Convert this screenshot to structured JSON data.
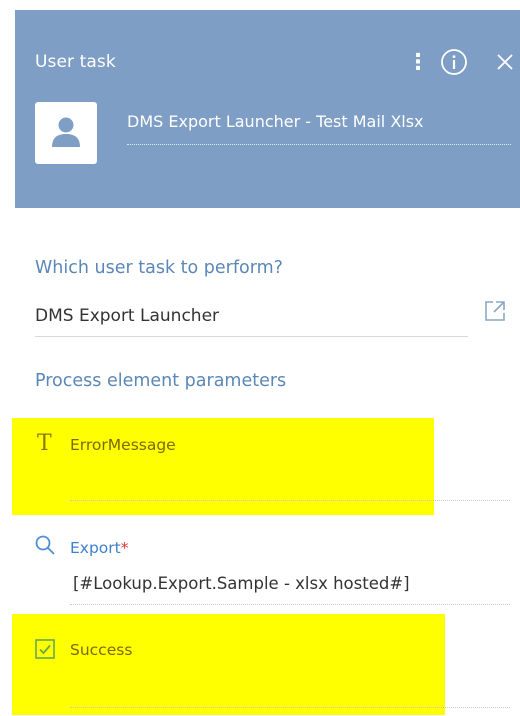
{
  "header": {
    "title": "User task",
    "element_name": "DMS Export Launcher - Test Mail Xlsx",
    "background_color": "#7f9ec6",
    "icons": [
      "more-vertical-icon",
      "info-icon",
      "close-icon",
      "user-avatar-icon"
    ]
  },
  "task": {
    "label": "Which user task to perform?",
    "value": "DMS Export Launcher",
    "open_icon": "open-external-icon"
  },
  "params": {
    "label": "Process element parameters",
    "items": [
      {
        "label": "ErrorMessage",
        "icon": "text-type-icon",
        "required": false,
        "value": ""
      },
      {
        "label": "Export",
        "icon": "lookup-search-icon",
        "required": true,
        "required_mark": "*",
        "value": "[#Lookup.Export.Sample - xlsx hosted#]"
      },
      {
        "label": "Success",
        "icon": "checkbox-icon",
        "required": false,
        "value": ""
      }
    ]
  },
  "colors": {
    "accent": "#5b87b8",
    "link": "#3f7fd0",
    "required": "#e53935",
    "highlight": "#ffff00"
  }
}
